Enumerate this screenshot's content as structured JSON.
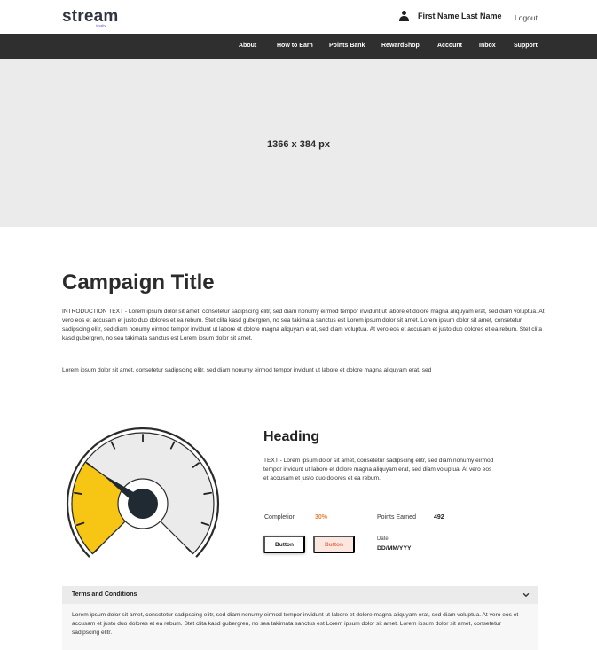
{
  "header": {
    "logo_text": "stream",
    "logo_subtext": "loyalty",
    "user_name": "First Name Last Name",
    "logout_label": "Logout"
  },
  "nav": {
    "items": [
      "About",
      "How to Earn",
      "Points Bank",
      "RewardShop",
      "Account",
      "Inbox",
      "Support"
    ]
  },
  "banner": {
    "placeholder_text": "1366 x 384 px"
  },
  "campaign": {
    "title": "Campaign Title",
    "intro": "INTRODUCTION TEXT - Lorem ipsum dolor sit amet, consetetur sadipscing elitr, sed diam nonumy eirmod tempor invidunt ut labore et dolore magna aliquyam erat, sed diam voluptua. At vero eos et accusam et justo duo dolores et ea rebum. Stet clita kasd gubergren, no sea takimata sanctus est Lorem ipsum dolor sit amet. Lorem ipsum dolor sit amet, consetetur sadipscing elitr, sed diam nonumy eirmod tempor invidunt ut labore et dolore magna aliquyam erat, sed diam voluptua. At vero eos et accusam et justo duo dolores et ea rebum. Stet clita kasd gubergren, no sea takimata sanctus est Lorem ipsum dolor sit amet.",
    "paragraph2": "Lorem ipsum dolor sit amet, consetetur sadipscing elitr, sed diam nonumy eirmod tempor invidunt ut labore et dolore magna aliquyam erat, sed"
  },
  "gauge": {
    "completion_fraction": 0.3,
    "fill_color": "#f7c614",
    "track_color": "#ebebeb",
    "needle_color": "#1f2a33"
  },
  "progress": {
    "heading": "Heading",
    "text": "TEXT - Lorem ipsum dolor sit amet, consetetur sadipscing elitr, sed diam nonumy eirmod tempor invidunt ut labore et dolore magna aliquyam erat, sed diam voluptua. At vero eos et accusam et justo duo dolores et ea rebum.",
    "completion_label": "Completion",
    "completion_value": "30%",
    "points_label": "Points Earned",
    "points_value": "492",
    "button1_label": "Button",
    "button2_label": "Button",
    "date_label": "Date",
    "date_value": "DD/MM/YYY"
  },
  "terms": {
    "title": "Terms and Conditions",
    "body": "Lorem ipsum dolor sit amet, consetetur sadipscing elitr, sed diam nonumy eirmod tempor invidunt ut labore et dolore magna aliquyam erat, sed diam voluptua. At vero eos et accusam et justo duo dolores et ea rebum. Stet clita kasd gubergren, no sea takimata sanctus est Lorem ipsum dolor sit amet. Lorem ipsum dolor sit amet, consetetur sadipscing elitr."
  },
  "colors": {
    "nav_bg": "#2f2f2f",
    "accent_orange": "#e8833a",
    "button_peach_bg": "#fbe7df",
    "button_peach_text": "#e36f50"
  }
}
